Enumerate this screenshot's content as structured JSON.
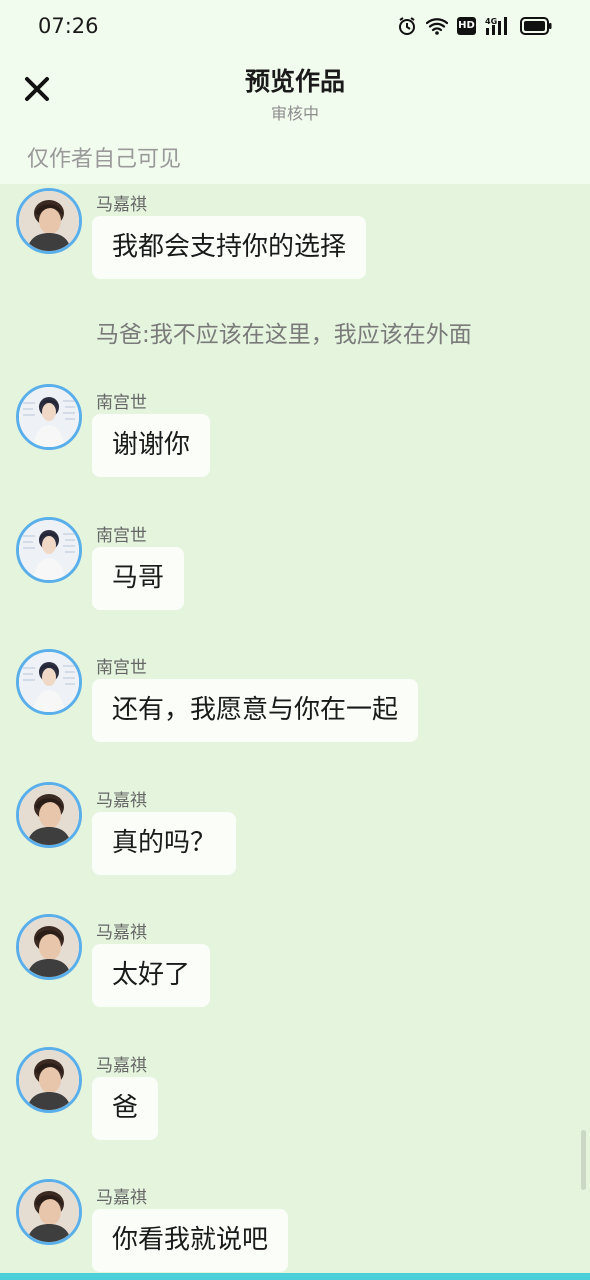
{
  "status_bar": {
    "time": "07:26",
    "icons": [
      "alarm-icon",
      "wifi-icon",
      "hd-icon",
      "signal-4g-icon",
      "battery-icon"
    ],
    "hd_label": "HD",
    "network_label": "4G"
  },
  "header": {
    "title": "预览作品",
    "subtitle": "审核中",
    "close_icon": "close-icon",
    "visibility_note": "仅作者自己可见"
  },
  "colors": {
    "background": "#e4f4dd",
    "header_bg": "#f1fcee",
    "bubble_bg": "#fafdf8",
    "avatar_border": "#5aafea",
    "bottom_strip": "#4ccfd9"
  },
  "messages": [
    {
      "sender": "马嘉祺",
      "text": "我都会支持你的选择",
      "avatar": "majiaqi"
    },
    {
      "narration": "马爸:我不应该在这里，我应该在外面"
    },
    {
      "sender": "南宫世",
      "text": "谢谢你",
      "avatar": "nangongshi"
    },
    {
      "sender": "南宫世",
      "text": "马哥",
      "avatar": "nangongshi"
    },
    {
      "sender": "南宫世",
      "text": "还有，我愿意与你在一起",
      "avatar": "nangongshi"
    },
    {
      "sender": "马嘉祺",
      "text": "真的吗？",
      "avatar": "majiaqi"
    },
    {
      "sender": "马嘉祺",
      "text": "太好了",
      "avatar": "majiaqi"
    },
    {
      "sender": "马嘉祺",
      "text": "爸",
      "avatar": "majiaqi"
    },
    {
      "sender": "马嘉祺",
      "text": "你看我就说吧",
      "avatar": "majiaqi"
    }
  ]
}
